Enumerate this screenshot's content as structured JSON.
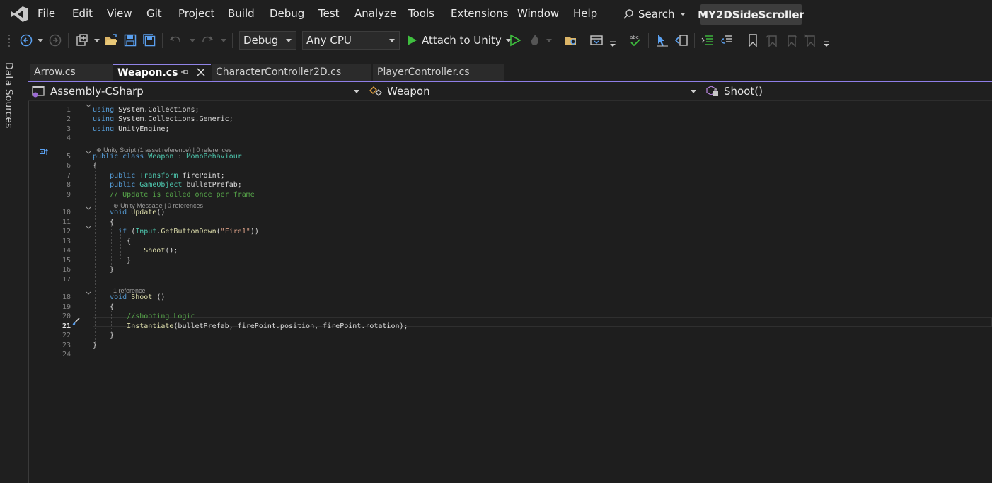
{
  "menu": {
    "items": [
      "File",
      "Edit",
      "View",
      "Git",
      "Project",
      "Build",
      "Debug",
      "Test",
      "Analyze",
      "Tools",
      "Extensions",
      "Window",
      "Help"
    ],
    "search_label": "Search",
    "project_name": "MY2DSideScroller"
  },
  "toolbar": {
    "config": "Debug",
    "platform": "Any CPU",
    "attach_label": "Attach to Unity"
  },
  "left_rail": {
    "label": "Data Sources"
  },
  "tabs": [
    {
      "label": "Arrow.cs",
      "active": false
    },
    {
      "label": "Weapon.cs",
      "active": true
    },
    {
      "label": "CharacterController2D.cs",
      "active": false
    },
    {
      "label": "PlayerController.cs",
      "active": false
    }
  ],
  "navbar": {
    "project": "Assembly-CSharp",
    "type": "Weapon",
    "member": "Shoot()"
  },
  "editor": {
    "current_line": 21,
    "line_numbers": [
      "1",
      "2",
      "3",
      "4",
      "5",
      "6",
      "7",
      "8",
      "9",
      "10",
      "11",
      "12",
      "13",
      "14",
      "15",
      "16",
      "17",
      "18",
      "19",
      "20",
      "21",
      "22",
      "23",
      "24"
    ],
    "codelens": {
      "class": "Unity Script (1 asset reference) | 0 references",
      "update": "Unity Message | 0 references",
      "shoot": "1 reference"
    },
    "lines": [
      [
        [
          "kw",
          "using"
        ],
        [
          "id",
          " System.Collections;"
        ]
      ],
      [
        [
          "kw",
          "using"
        ],
        [
          "id",
          " System.Collections.Generic;"
        ]
      ],
      [
        [
          "kw",
          "using"
        ],
        [
          "id",
          " UnityEngine;"
        ]
      ],
      [],
      [
        [
          "kw",
          "public class "
        ],
        [
          "ty",
          "Weapon"
        ],
        [
          "id",
          " : "
        ],
        [
          "ty",
          "MonoBehaviour"
        ]
      ],
      [
        [
          "id",
          "{"
        ]
      ],
      [
        [
          "id",
          "    "
        ],
        [
          "kw",
          "public "
        ],
        [
          "ty",
          "Transform"
        ],
        [
          "id",
          " firePoint;"
        ]
      ],
      [
        [
          "id",
          "    "
        ],
        [
          "kw",
          "public "
        ],
        [
          "ty",
          "GameObject"
        ],
        [
          "id",
          " bulletPrefab;"
        ]
      ],
      [
        [
          "id",
          "    "
        ],
        [
          "cm",
          "// Update is called once per frame"
        ]
      ],
      [
        [
          "id",
          "    "
        ],
        [
          "kw",
          "void "
        ],
        [
          "fn",
          "Update"
        ],
        [
          "id",
          "()"
        ]
      ],
      [
        [
          "id",
          "    {"
        ]
      ],
      [
        [
          "id",
          "      "
        ],
        [
          "kw",
          "if"
        ],
        [
          "id",
          " ("
        ],
        [
          "ty",
          "Input"
        ],
        [
          "id",
          "."
        ],
        [
          "fn",
          "GetButtonDown"
        ],
        [
          "id",
          "("
        ],
        [
          "st",
          "\"Fire1\""
        ],
        [
          "id",
          "))"
        ]
      ],
      [
        [
          "id",
          "        {"
        ]
      ],
      [
        [
          "id",
          "            "
        ],
        [
          "fn",
          "Shoot"
        ],
        [
          "id",
          "();"
        ]
      ],
      [
        [
          "id",
          "        }"
        ]
      ],
      [
        [
          "id",
          "    }"
        ]
      ],
      [],
      [
        [
          "id",
          "    "
        ],
        [
          "kw",
          "void "
        ],
        [
          "fn",
          "Shoot"
        ],
        [
          "id",
          " ()"
        ]
      ],
      [
        [
          "id",
          "    {"
        ]
      ],
      [
        [
          "id",
          "        "
        ],
        [
          "cm",
          "//shooting Logic"
        ]
      ],
      [
        [
          "id",
          "        "
        ],
        [
          "fn",
          "Instantiate"
        ],
        [
          "id",
          "(bulletPrefab, firePoint.position, firePoint.rotation);"
        ]
      ],
      [
        [
          "id",
          "    }"
        ]
      ],
      [
        [
          "id",
          "}"
        ]
      ],
      []
    ]
  },
  "colors": {
    "accent": "#8f7ee7",
    "keyword": "#569cd6",
    "type": "#4ec9b0",
    "method": "#dcdcaa",
    "comment": "#57a64a",
    "string": "#d69d85",
    "play_green": "#3fbf3f"
  },
  "icons": [
    "vs-logo-icon",
    "search-icon",
    "back-icon",
    "forward-icon",
    "new-project-icon",
    "open-folder-icon",
    "save-icon",
    "save-all-icon",
    "undo-icon",
    "redo-icon",
    "play-icon",
    "play-outline-icon",
    "hot-reload-icon",
    "pin-icon",
    "close-icon",
    "class-icon",
    "method-icon",
    "csharp-project-icon",
    "bookmark-icon",
    "comment-icon",
    "uncomment-icon",
    "spellcheck-icon",
    "quick-action-icon"
  ]
}
